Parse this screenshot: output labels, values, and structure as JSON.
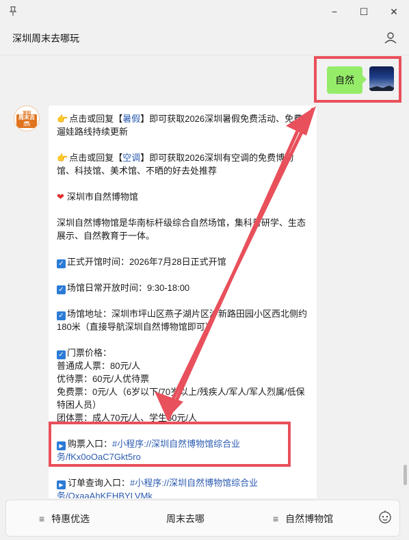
{
  "window": {
    "title": "深圳周末去哪玩",
    "controls": {
      "minimize": "−",
      "maximize": "☐",
      "close": "✕"
    }
  },
  "user_message": {
    "text": "自然"
  },
  "bot_avatar": {
    "line1": "深圳",
    "line2": "周末去哪",
    "line3": "深圳"
  },
  "bot_message": {
    "p1_before": "点击或回复【",
    "p1_keyword": "暑假",
    "p1_after": "】即可获取2026深圳暑假免费活动、免费遛娃路线持续更新",
    "p2_before": "点击或回复【",
    "p2_keyword": "空调",
    "p2_after": "】即可获取2026深圳有空调的免费博物馆、科技馆、美术馆、不晒的好去处推荐",
    "venue_name": "深圳市自然博物馆",
    "description": "深圳自然博物馆是华南标杆级综合自然场馆，集科普研学、生态展示、自然教育于一体。",
    "opening_date": "正式开馆时间：2026年7月28日正式开馆",
    "hours": "场馆日常开放时间：9:30-18:00",
    "address": "场馆地址：深圳市坪山区燕子湖片区沙新路田园小区西北侧约180米（直接导航深圳自然博物馆即可）",
    "ticket_header": "门票价格：",
    "ticket_adult": "普通成人票：80元/人",
    "ticket_discount": "优待票：60元/人优待票",
    "ticket_free": "免费票：0元/人（6岁以下/70岁以上/残疾人/军人/军人烈属/低保特困人员）",
    "ticket_group": "团体票：成人70元/人、学生50元/人",
    "purchase_label": "购票入口：",
    "purchase_link": "#小程序://深圳自然博物馆综合业务/fKx0oOaC7Gkt5ro",
    "order_label": "订单查询入口：",
    "order_link": "#小程序://深圳自然博物馆综合业务/OxaaAhKEHBYLVMk"
  },
  "bottom_menu": [
    {
      "label": "特惠优选"
    },
    {
      "label": "周末去哪"
    },
    {
      "label": "自然博物馆"
    }
  ],
  "colors": {
    "user_bubble": "#95ec69",
    "link": "#2a5ab0",
    "annotation": "#e8505b"
  },
  "icons": [
    "pin-icon",
    "profile-icon",
    "heart-icon",
    "check-icon",
    "play-icon",
    "bot-service-icon"
  ]
}
